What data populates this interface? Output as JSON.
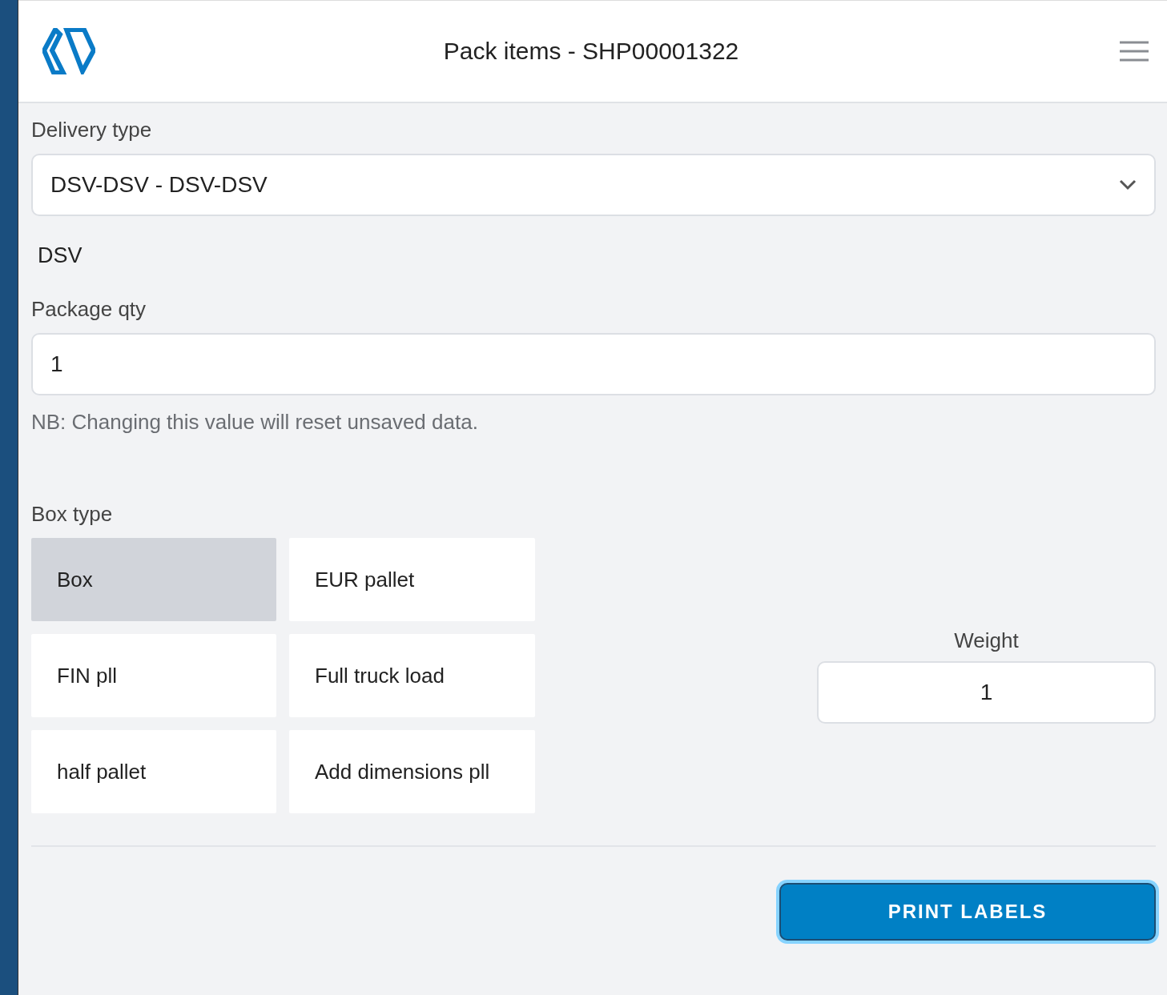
{
  "header": {
    "title": "Pack items - SHP00001322"
  },
  "delivery_type": {
    "label": "Delivery type",
    "value": "DSV-DSV - DSV-DSV"
  },
  "carrier": "DSV",
  "package_qty": {
    "label": "Package qty",
    "value": "1",
    "note": "NB: Changing this value will reset unsaved data."
  },
  "box_type": {
    "label": "Box type",
    "options": [
      {
        "label": "Box",
        "selected": true
      },
      {
        "label": "EUR pallet",
        "selected": false
      },
      {
        "label": "FIN pll",
        "selected": false
      },
      {
        "label": "Full truck load",
        "selected": false
      },
      {
        "label": "half pallet",
        "selected": false
      },
      {
        "label": "Add dimensions pll",
        "selected": false
      }
    ]
  },
  "weight": {
    "label": "Weight",
    "value": "1"
  },
  "print_button": {
    "label": "PRINT LABELS",
    "focused": true
  }
}
